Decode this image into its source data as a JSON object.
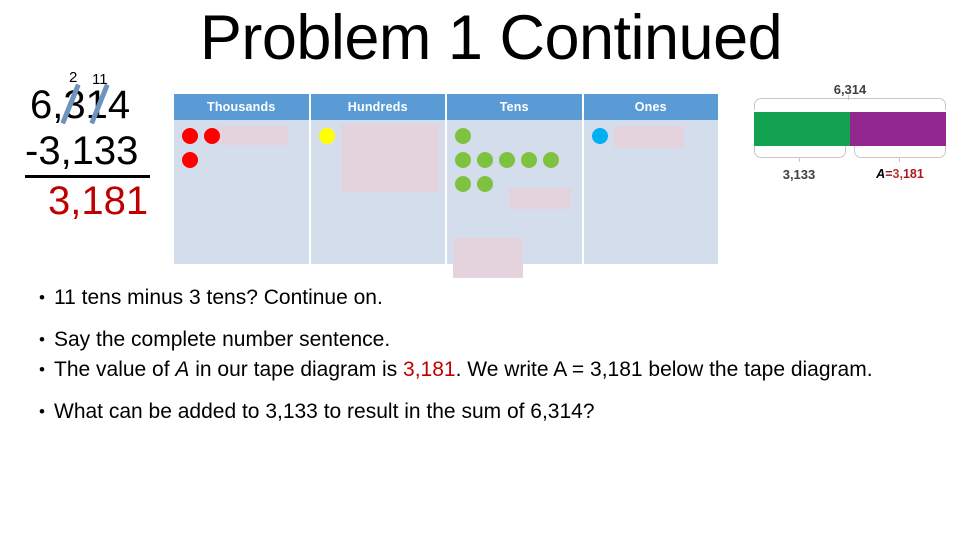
{
  "slide": {
    "title": "Problem 1 Continued"
  },
  "subtraction": {
    "regroup_hundreds": "2",
    "regroup_tens": "11",
    "minuend": "6,314",
    "subtrahend": "-3,133",
    "difference": "3,181"
  },
  "place_value_chart": {
    "columns": [
      {
        "header": "Thousands",
        "dot_color": "#FF0000",
        "rows": [
          2,
          1
        ]
      },
      {
        "header": "Hundreds",
        "dot_color": "#FFFF00",
        "rows": [
          1
        ]
      },
      {
        "header": "Tens",
        "dot_color": "#7FC241",
        "rows": [
          1,
          5,
          2
        ]
      },
      {
        "header": "Ones",
        "dot_color": "#00B0F0",
        "rows": [
          1
        ]
      }
    ]
  },
  "tape_diagram": {
    "total_label": "6,314",
    "left_label": "3,133",
    "right_label_var": "A",
    "right_label_eq": "=",
    "right_label_value_a": "3,",
    "right_label_value_b": "181",
    "green_color": "#13A350",
    "purple_color": "#922790"
  },
  "bullets": [
    {
      "marker": "•",
      "text": "11 tens minus 3 tens? Continue on."
    },
    {
      "marker": "•",
      "text": "Say the complete number sentence."
    },
    {
      "marker": "•",
      "parts": {
        "pre": "The value of ",
        "var": "A",
        "mid": " in our tape diagram is ",
        "highlight": "3,181",
        "post": ".  We write A = 3,181 below the tape diagram."
      }
    },
    {
      "marker": "•",
      "text": "What can be added to 3,133 to result in the sum of 6,314?"
    }
  ]
}
